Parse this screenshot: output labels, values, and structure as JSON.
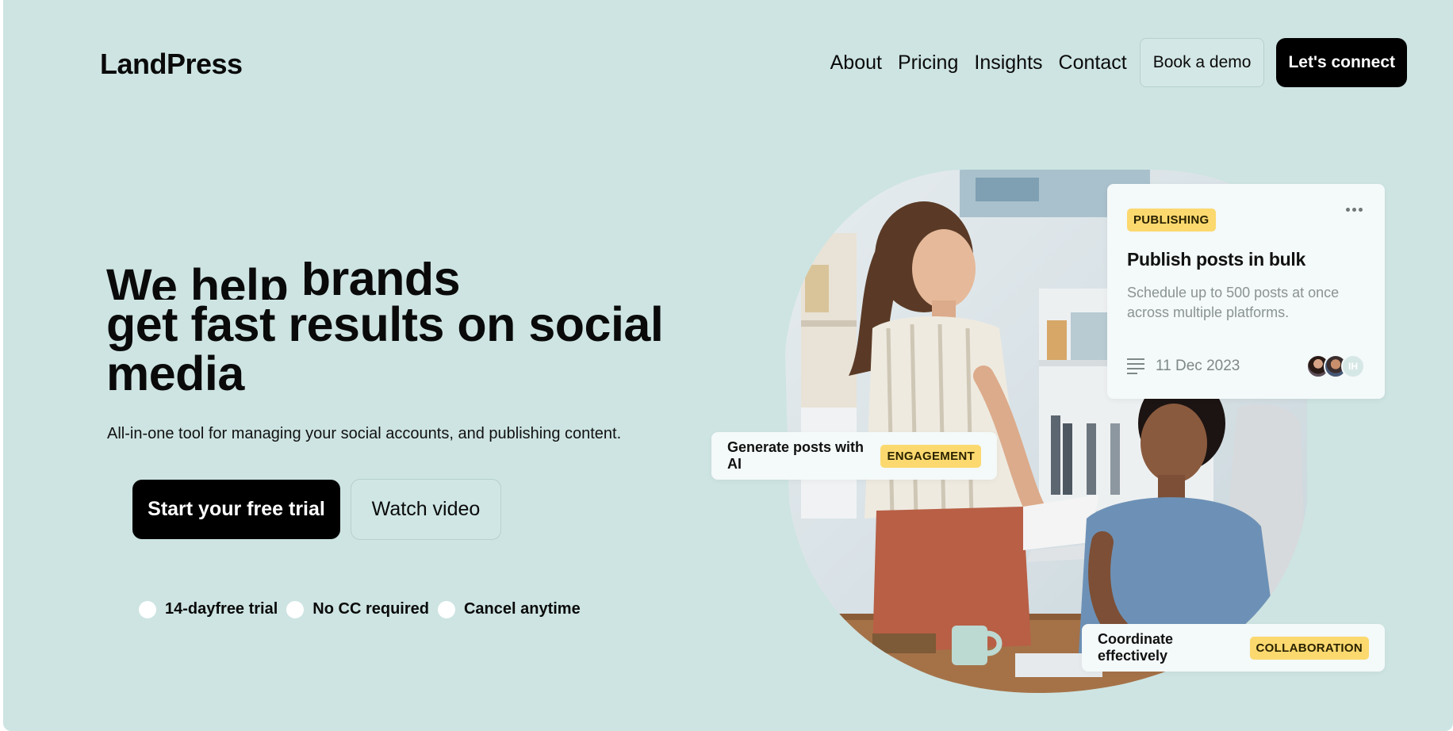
{
  "nav": {
    "logo": "LandPress",
    "links": [
      "About",
      "Pricing",
      "Insights",
      "Contact"
    ],
    "demo_label": "Book a demo",
    "connect_label": "Let's connect"
  },
  "hero": {
    "title_prefix": "We help",
    "title_rotating": "brands",
    "title_line2": "get fast results on social",
    "title_line3": "media",
    "subtitle": "All-in-one tool for managing your social accounts, and publishing content.",
    "cta_primary": "Start your free trial",
    "cta_secondary": "Watch video",
    "perks": [
      "14-dayfree trial",
      "No CC required",
      "Cancel anytime"
    ]
  },
  "cards": {
    "publish": {
      "badge": "PUBLISHING",
      "title": "Publish posts in bulk",
      "description": "Schedule up to 500 posts at once across multiple platforms.",
      "date": "11 Dec 2023",
      "avatar_initials": "IH"
    },
    "ai": {
      "label": "Generate posts with AI",
      "badge": "ENGAGEMENT"
    },
    "collab": {
      "label": "Coordinate effectively",
      "badge": "COLLABORATION"
    }
  },
  "colors": {
    "background": "#cde4e2",
    "badge": "#fbd96f",
    "primary_button": "#000000",
    "card": "#f4f9f9"
  },
  "icons": {
    "more": "more-horizontal-icon",
    "document": "document-lines-icon",
    "perk": "circle-check-icon"
  }
}
